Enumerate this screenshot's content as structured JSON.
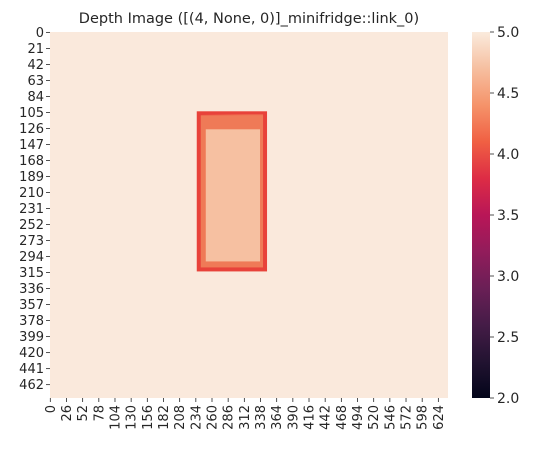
{
  "chart_data": {
    "type": "heatmap",
    "title": "Depth Image ([(4, None, 0)]_minifridge::link_0)",
    "xlabel": "",
    "ylabel": "",
    "image_width": 640,
    "image_height": 480,
    "x_ticks": [
      0,
      26,
      52,
      78,
      104,
      130,
      156,
      182,
      208,
      234,
      260,
      286,
      312,
      338,
      364,
      390,
      416,
      442,
      468,
      494,
      520,
      546,
      572,
      598,
      624
    ],
    "y_ticks": [
      0,
      21,
      42,
      63,
      84,
      105,
      126,
      147,
      168,
      189,
      210,
      231,
      252,
      273,
      294,
      315,
      336,
      357,
      378,
      399,
      420,
      441,
      462
    ],
    "colorbar": {
      "min": 2.0,
      "max": 5.0,
      "ticks": [
        "2.0",
        "2.5",
        "3.0",
        "3.5",
        "4.0",
        "4.5",
        "5.0"
      ]
    },
    "background_value": 5.0,
    "object": {
      "name": "minifridge",
      "x_range": [
        236,
        349
      ],
      "y_range": [
        104,
        314
      ],
      "border_value": 4.05,
      "inner_value": 4.7,
      "edge_shading_value": 4.4
    },
    "grid": false,
    "colormap": "rocket",
    "colors": {
      "background": "#fae9dc",
      "object_inner": "#f6c0a1",
      "object_border": "#e8423a",
      "object_edge": "#ef7a57"
    }
  }
}
